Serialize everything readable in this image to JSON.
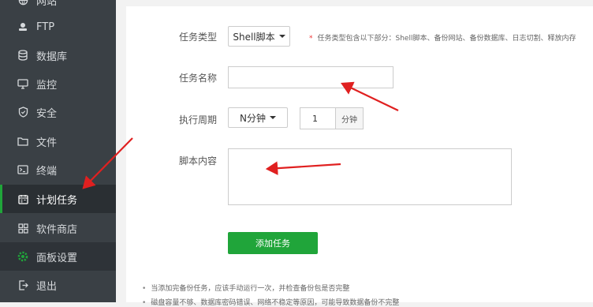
{
  "sidebar": {
    "items": [
      {
        "label": "网站",
        "icon": "globe-icon"
      },
      {
        "label": "FTP",
        "icon": "ftp-icon"
      },
      {
        "label": "数据库",
        "icon": "database-icon"
      },
      {
        "label": "监控",
        "icon": "monitor-icon"
      },
      {
        "label": "安全",
        "icon": "shield-icon"
      },
      {
        "label": "文件",
        "icon": "folder-icon"
      },
      {
        "label": "终端",
        "icon": "terminal-icon"
      },
      {
        "label": "计划任务",
        "icon": "calendar-icon"
      },
      {
        "label": "软件商店",
        "icon": "apps-grid-icon"
      },
      {
        "label": "面板设置",
        "icon": "gear-icon"
      },
      {
        "label": "退出",
        "icon": "logout-icon"
      }
    ],
    "active_index": 7
  },
  "form": {
    "task_type_label": "任务类型",
    "task_type_value": "Shell脚本",
    "task_type_hint_star": "*",
    "task_type_hint": "任务类型包含以下部分：Shell脚本、备份网站、备份数据库、日志切割、释放内存",
    "task_name_label": "任务名称",
    "task_name_value": "",
    "period_label": "执行周期",
    "period_value": "N分钟",
    "minute_value": "1",
    "minute_unit": "分钟",
    "script_label": "脚本内容",
    "script_value": "",
    "submit_label": "添加任务"
  },
  "notes": [
    "当添加完备份任务，应该手动运行一次，并检查备份包是否完整",
    "磁盘容量不够、数据库密码错误、网络不稳定等原因，可能导致数据备份不完整"
  ],
  "colors": {
    "sidebar_bg": "#3a4045",
    "accent_green": "#20a53a",
    "annotation_red": "#e02020"
  }
}
